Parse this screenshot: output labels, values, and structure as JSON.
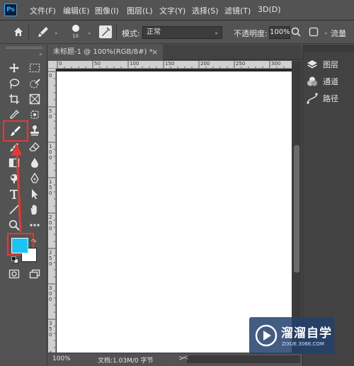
{
  "app": {
    "logo_text": "Ps"
  },
  "menubar": {
    "items": [
      "文件(F)",
      "编辑(E)",
      "图像(I)",
      "图层(L)",
      "文字(Y)",
      "选择(S)",
      "滤镜(T)",
      "3D(D)"
    ]
  },
  "options_bar": {
    "brush_size": "10",
    "mode_label": "模式:",
    "mode_value": "正常",
    "opacity_label": "不透明度:",
    "opacity_value": "100%",
    "flow_label": "流量"
  },
  "document": {
    "tab_title": "未标题-1 @ 100%(RGB/8#) *",
    "tab_close": "×",
    "ruler_top_labels": [
      "0",
      "50",
      "100",
      "150",
      "200",
      "250",
      "300"
    ],
    "ruler_left_labels": [
      "0",
      "5",
      "0",
      "1",
      "0",
      "0",
      "1",
      "5",
      "0",
      "2",
      "0",
      "0",
      "2",
      "5",
      "0",
      "3",
      "0",
      "0",
      "3",
      "5",
      "0",
      "4",
      "0",
      "0",
      "4",
      "5",
      "0",
      "5",
      "0",
      "0"
    ]
  },
  "statusbar": {
    "zoom": "100%",
    "doc_info": "文档:1.03M/0 字节",
    "arrow": ">",
    "scroll_left": "<"
  },
  "panels": {
    "items": [
      {
        "label": "图层",
        "icon": "layers-icon"
      },
      {
        "label": "通道",
        "icon": "channels-icon"
      },
      {
        "label": "路径",
        "icon": "paths-icon"
      }
    ]
  },
  "colors": {
    "foreground": "#18c5f5",
    "background": "#ffffff",
    "highlight": "#e23b35"
  },
  "watermark": {
    "title": "溜溜自学",
    "url": "ZIXUE.3066.COM"
  }
}
